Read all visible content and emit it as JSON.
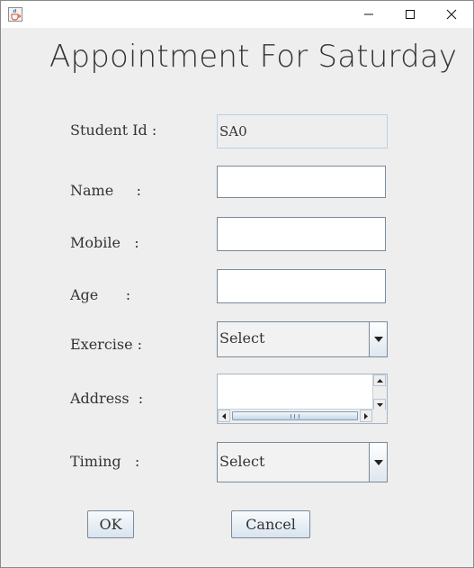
{
  "window": {
    "minimize_icon": "minimize-icon",
    "maximize_icon": "maximize-icon",
    "close_icon": "close-icon",
    "app_icon": "java-cup-icon"
  },
  "heading": "Appointment For Saturday",
  "form": {
    "student_id_label": "Student Id :",
    "student_id_value": "SA0",
    "name_label": "Name     :",
    "name_value": "",
    "mobile_label": "Mobile   :",
    "mobile_value": "",
    "age_label": "Age      :",
    "age_value": "",
    "exercise_label": "Exercise :",
    "exercise_selected": "Select",
    "address_label": "Address  :",
    "address_value": "",
    "timing_label": "Timing   :",
    "timing_selected": "Select"
  },
  "buttons": {
    "ok_label": "OK",
    "cancel_label": "Cancel"
  },
  "colors": {
    "background": "#eeeeee",
    "border": "#7a8a99",
    "button_gradient_top": "#f8fbfe",
    "button_gradient_bottom": "#d9e3ee"
  }
}
